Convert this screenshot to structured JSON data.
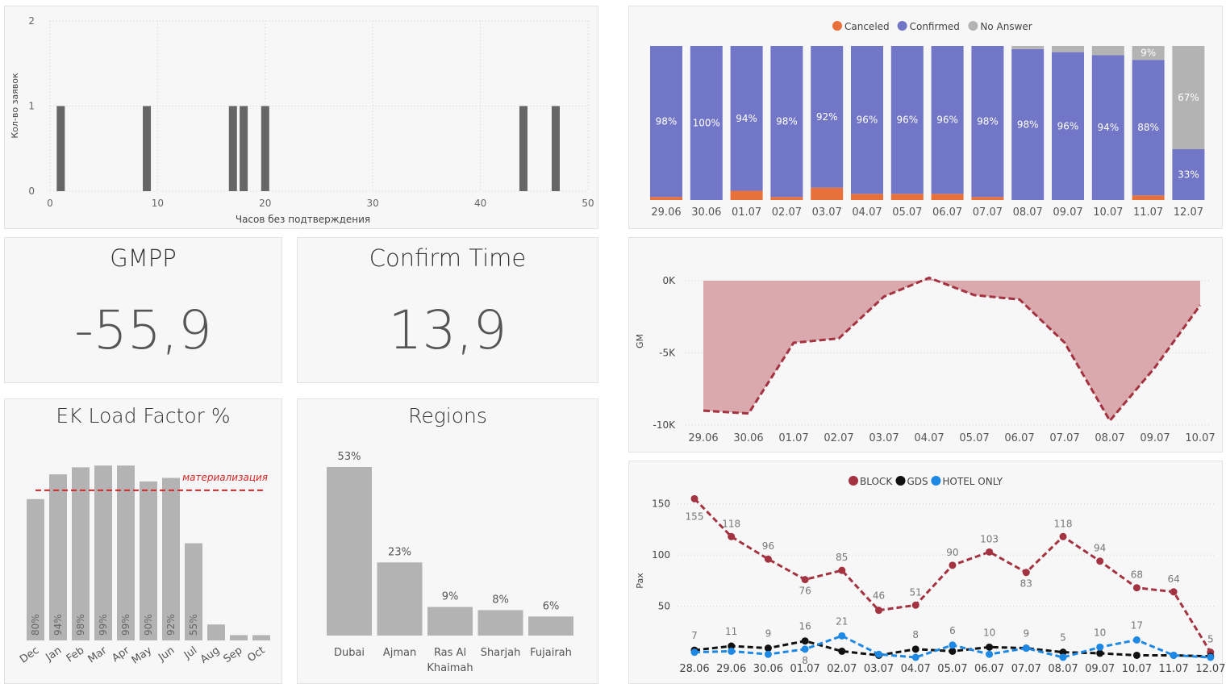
{
  "histogram": {
    "chart_data": {
      "type": "bar",
      "xlabel": "Часов без подтверждения",
      "ylabel": "Кол-во заявок",
      "xlim": [
        0,
        50
      ],
      "ylim": [
        0,
        2
      ],
      "x_ticks": [
        "0",
        "10",
        "20",
        "30",
        "40",
        "50"
      ],
      "y_ticks": [
        "0",
        "1",
        "2"
      ],
      "x": [
        1,
        9,
        17,
        18,
        20,
        44,
        47
      ],
      "values": [
        1,
        1,
        1,
        1,
        1,
        1,
        1
      ],
      "grid": true,
      "bar_color": "#666666"
    }
  },
  "gmpp": {
    "title": "GMPP",
    "value": "-55,9"
  },
  "confirm_time": {
    "title": "Confirm Time",
    "value": "13,9"
  },
  "load_factor": {
    "title": "EK Load Factor %",
    "chart_data": {
      "type": "bar",
      "categories": [
        "Dec",
        "Jan",
        "Feb",
        "Mar",
        "Apr",
        "May",
        "Jun",
        "Jul",
        "Aug",
        "Sep",
        "Oct"
      ],
      "values": [
        80,
        94,
        98,
        99,
        99,
        90,
        92,
        55,
        9,
        3,
        3
      ],
      "labels": [
        "80%",
        "94%",
        "98%",
        "99%",
        "99%",
        "90%",
        "92%",
        "55%",
        "",
        "",
        ""
      ],
      "ylim": [
        0,
        100
      ],
      "reference_line": {
        "label": "материализация",
        "value": 85,
        "color": "#d62728"
      },
      "bar_color": "#b3b3b3"
    }
  },
  "regions": {
    "title": "Regions",
    "chart_data": {
      "type": "bar",
      "categories": [
        "Dubai",
        "Ajman",
        "Ras Al Khaimah",
        "Sharjah",
        "Fujairah"
      ],
      "category_lines": [
        [
          "Dubai"
        ],
        [
          "Ajman"
        ],
        [
          "Ras Al",
          "Khaimah"
        ],
        [
          "Sharjah"
        ],
        [
          "Fujairah"
        ]
      ],
      "values": [
        53,
        23,
        9,
        8,
        6
      ],
      "labels": [
        "53%",
        "23%",
        "9%",
        "8%",
        "6%"
      ],
      "ylim": [
        0,
        53
      ],
      "bar_color": "#b3b3b3"
    }
  },
  "stacked": {
    "chart_data": {
      "type": "bar",
      "stacked": true,
      "legend_position": "top-center",
      "categories": [
        "29.06",
        "30.06",
        "01.07",
        "02.07",
        "03.07",
        "04.07",
        "05.07",
        "06.07",
        "07.07",
        "08.07",
        "09.07",
        "10.07",
        "11.07",
        "12.07"
      ],
      "series": [
        {
          "name": "Canceled",
          "color": "#e8703a",
          "values": [
            2,
            0,
            6,
            2,
            8,
            4,
            4,
            4,
            2,
            0,
            0,
            0,
            3,
            0
          ]
        },
        {
          "name": "Confirmed",
          "color": "#7276c6",
          "values": [
            98,
            100,
            94,
            98,
            92,
            96,
            96,
            96,
            98,
            98,
            96,
            94,
            88,
            33
          ]
        },
        {
          "name": "No Answer",
          "color": "#b3b3b3",
          "values": [
            0,
            0,
            0,
            0,
            0,
            0,
            0,
            0,
            0,
            2,
            4,
            6,
            9,
            67
          ]
        }
      ],
      "labels": {
        "Confirmed": [
          "98%",
          "100%",
          "94%",
          "98%",
          "92%",
          "96%",
          "96%",
          "96%",
          "98%",
          "98%",
          "96%",
          "94%",
          "88%",
          "33%"
        ],
        "No Answer": [
          "",
          "",
          "",
          "",
          "",
          "",
          "",
          "",
          "",
          "",
          "",
          "",
          "9%",
          "67%"
        ]
      },
      "ylim": [
        0,
        100
      ]
    }
  },
  "gm_area": {
    "chart_data": {
      "type": "area",
      "ylabel": "GM",
      "x": [
        "29.06",
        "30.06",
        "01.07",
        "02.07",
        "03.07",
        "04.07",
        "05.07",
        "06.07",
        "07.07",
        "08.07",
        "09.07",
        "10.07"
      ],
      "y_ticks": [
        "0K",
        "-5K",
        "-10K"
      ],
      "values": [
        -9000,
        -9200,
        -4300,
        -4000,
        -1100,
        200,
        -1000,
        -1300,
        -4300,
        -9700,
        -6000,
        -1700
      ],
      "ylim": [
        -10000,
        0
      ],
      "line_color": "#a33340",
      "fill_color": "#d9a9ae"
    }
  },
  "pax": {
    "chart_data": {
      "type": "line",
      "ylabel": "Pax",
      "legend_position": "top-center",
      "x": [
        "28.06",
        "29.06",
        "30.06",
        "01.07",
        "02.07",
        "03.07",
        "04.07",
        "05.07",
        "06.07",
        "07.07",
        "08.07",
        "09.07",
        "10.07",
        "11.07",
        "12.07"
      ],
      "y_ticks": [
        "150",
        "100",
        "50"
      ],
      "ylim": [
        0,
        160
      ],
      "series": [
        {
          "name": "BLOCK",
          "color": "#a33340",
          "values": [
            155,
            118,
            96,
            76,
            85,
            46,
            51,
            90,
            103,
            83,
            118,
            94,
            68,
            64,
            5
          ],
          "labels": [
            "155",
            "118",
            "96",
            "76",
            "85",
            "46",
            "51",
            "90",
            "103",
            "83",
            "118",
            "94",
            "68",
            "64",
            "5"
          ]
        },
        {
          "name": "GDS",
          "color": "#111111",
          "values": [
            7,
            11,
            9,
            16,
            6,
            2,
            8,
            6,
            10,
            9,
            5,
            4,
            2,
            2,
            1
          ],
          "labels": [
            "7",
            "11",
            "9",
            "16",
            "",
            "",
            "8",
            "",
            "10",
            "9",
            "5",
            "",
            "",
            "",
            ""
          ]
        },
        {
          "name": "HOTEL ONLY",
          "color": "#1e88e5",
          "values": [
            5,
            6,
            3,
            8,
            21,
            3,
            0,
            12,
            3,
            9,
            0,
            10,
            17,
            2,
            0
          ],
          "labels": [
            "",
            "",
            "",
            "8",
            "21",
            "",
            "",
            "6",
            "",
            "",
            "",
            "10",
            "17",
            "",
            ""
          ]
        }
      ]
    }
  }
}
